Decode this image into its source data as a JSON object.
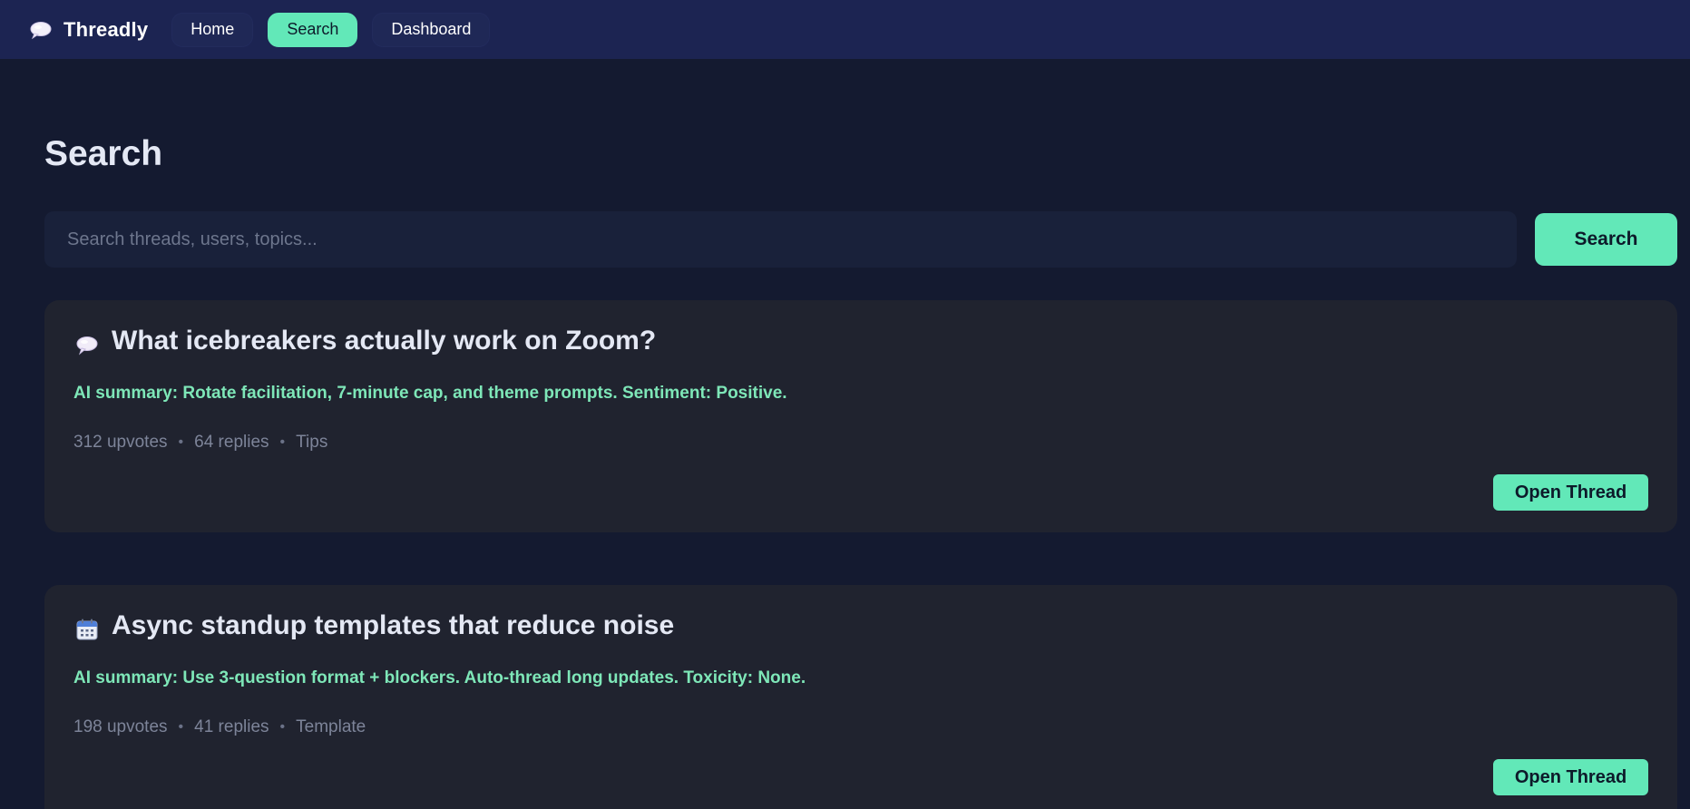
{
  "app": {
    "name": "Threadly",
    "logo_icon": "speech-bubble-icon"
  },
  "nav": {
    "items": [
      {
        "label": "Home",
        "active": false
      },
      {
        "label": "Search",
        "active": true
      },
      {
        "label": "Dashboard",
        "active": false
      }
    ]
  },
  "page": {
    "title": "Search"
  },
  "search": {
    "placeholder": "Search threads, users, topics...",
    "value": "",
    "button_label": "Search"
  },
  "results": [
    {
      "icon": "speech-bubble-icon",
      "title": "What icebreakers actually work on Zoom?",
      "summary": "AI summary: Rotate facilitation, 7-minute cap, and theme prompts. Sentiment: Positive.",
      "upvotes": "312 upvotes",
      "replies": "64 replies",
      "tag": "Tips",
      "button_label": "Open Thread"
    },
    {
      "icon": "calendar-icon",
      "title": "Async standup templates that reduce noise",
      "summary": "AI summary: Use 3-question format + blockers. Auto-thread long updates. Toxicity: None.",
      "upvotes": "198 upvotes",
      "replies": "41 replies",
      "tag": "Template",
      "button_label": "Open Thread"
    }
  ],
  "colors": {
    "accent": "#62e8b8",
    "background": "#141a30",
    "topbar": "#1c2452",
    "card": "#20232f",
    "summary_text": "#7ee7b8"
  }
}
